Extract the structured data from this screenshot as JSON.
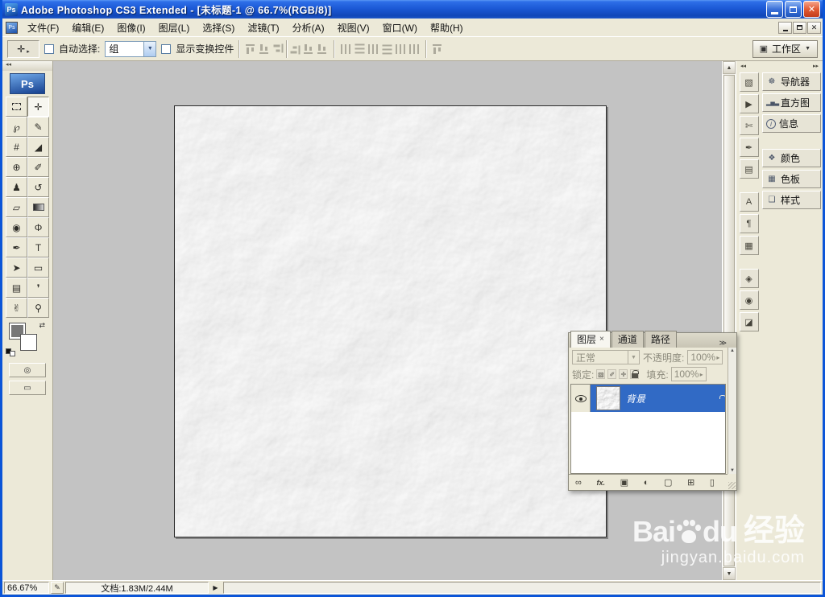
{
  "window": {
    "title": "Adobe Photoshop CS3 Extended - [未标题-1 @ 66.7%(RGB/8)]"
  },
  "menu": {
    "items": [
      "文件(F)",
      "编辑(E)",
      "图像(I)",
      "图层(L)",
      "选择(S)",
      "滤镜(T)",
      "分析(A)",
      "视图(V)",
      "窗口(W)",
      "帮助(H)"
    ]
  },
  "options": {
    "auto_select_label": "自动选择:",
    "auto_select_value": "组",
    "show_transform_label": "显示变换控件",
    "workspace_label": "工作区"
  },
  "toolbox": {
    "logo": "Ps"
  },
  "dock": {
    "groups": [
      [
        "导航器",
        "直方图",
        "信息"
      ],
      [
        "颜色",
        "色板",
        "样式"
      ]
    ]
  },
  "layers_panel": {
    "tabs": [
      "图层",
      "通道",
      "路径"
    ],
    "tab_close": "×",
    "blend_mode": "正常",
    "opacity_label": "不透明度:",
    "opacity_value": "100%",
    "lock_label": "锁定:",
    "fill_label": "填充:",
    "fill_value": "100%",
    "layer_name": "背景"
  },
  "status": {
    "zoom": "66.67%",
    "doc_info": "文档:1.83M/2.44M"
  },
  "watermark": {
    "bai": "Bai",
    "du": "du",
    "brand": "经验",
    "url": "jingyan.baidu.com"
  },
  "colors": {
    "titlebar_blue": "#1C59D6",
    "selection_blue": "#316AC5",
    "chrome": "#ECE9D8",
    "canvas_gray": "#C3C3C3"
  },
  "icons": {
    "close": "✕",
    "dropdown": "▼",
    "flyout": "▸",
    "menu_arrow": "▶",
    "collapse": "◂◂",
    "expand": "▸▸",
    "chevrons": "≫",
    "up": "▲",
    "down": "▼",
    "tool_move": "✛",
    "tool_lasso": "℘",
    "tool_quick_select": "✎",
    "tool_crop": "#",
    "tool_slice": "◢",
    "tool_healing": "⊕",
    "tool_brush": "✐",
    "tool_stamp": "♟",
    "tool_history": "↺",
    "tool_eraser": "▱",
    "tool_blur": "◉",
    "tool_dodge": "Φ",
    "tool_pen": "✒",
    "tool_type": "T",
    "tool_path_select": "➤",
    "tool_shape": "▭",
    "tool_notes": "▤",
    "tool_eyedropper": "❜",
    "tool_hand": "✌",
    "tool_zoom": "⚲",
    "swap": "⇄",
    "quick_mask": "◎",
    "screen_mode": "▭",
    "workspace": "▣",
    "status_tool": "✎",
    "nav": "☸",
    "histogram": "▂▅▃",
    "info": "i",
    "color": "❖",
    "swatches": "▦",
    "styles": "❑",
    "strip": [
      "▧",
      "▶",
      "✄",
      "✒",
      "▤",
      "A",
      "¶",
      "▦",
      "◈",
      "◉",
      "◪"
    ],
    "lock_transparent": "▧",
    "lock_pixels": "✐",
    "lock_position": "✛",
    "panel_link": "∞",
    "panel_fx": "fx.",
    "panel_mask": "▣",
    "panel_adjust": "◐",
    "panel_group": "▢",
    "panel_new": "⊞",
    "panel_trash": "▯"
  }
}
